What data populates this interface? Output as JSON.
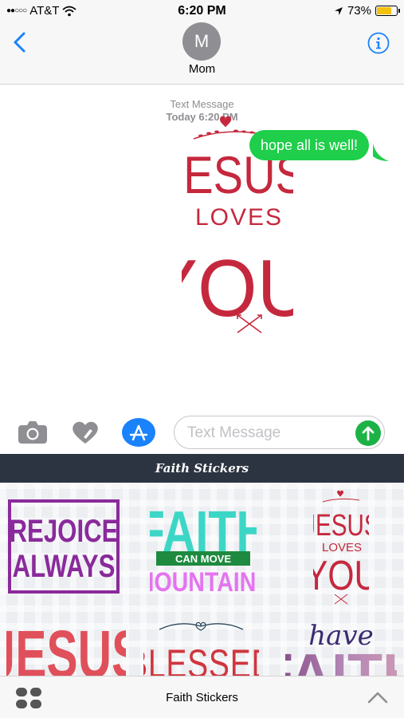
{
  "status": {
    "carrier": "AT&T",
    "signal_dots": "●●○○○",
    "time": "6:20 PM",
    "battery": "73%",
    "battery_level": 0.73,
    "battery_color": "#f4c20d"
  },
  "header": {
    "avatar_initial": "M",
    "contact": "Mom"
  },
  "conversation": {
    "timestamp_label": "Text Message",
    "timestamp_time": "Today 6:20 PM",
    "outgoing_message": "hope all is well!",
    "bubble_color": "#1fce4a"
  },
  "input": {
    "placeholder": "Text Message",
    "value": ""
  },
  "drawer": {
    "title": "Faith Stickers",
    "stickers": [
      {
        "name": "rejoice-always",
        "lines": [
          "REJOICE",
          "ALWAYS"
        ]
      },
      {
        "name": "faith-can-move-mountains",
        "lines": [
          "FAITH",
          "CAN MOVE",
          "MOUNTAINS"
        ]
      },
      {
        "name": "jesus-loves-you",
        "lines": [
          "JESUS",
          "LOVES",
          "YOU"
        ]
      },
      {
        "name": "jesus",
        "lines": [
          "JESUS"
        ]
      },
      {
        "name": "blessed",
        "lines": [
          "BLESSED"
        ]
      },
      {
        "name": "have-faith",
        "lines": [
          "have",
          "FAITH"
        ]
      }
    ]
  },
  "main_sticker": {
    "lines": [
      "JESUS",
      "LOVES",
      "YOU"
    ]
  },
  "bottom_bar": {
    "title": "Faith Stickers"
  },
  "colors": {
    "ios_blue": "#1a82fb",
    "sticker_red": "#c5283d",
    "rejoice_purple": "#8a2a9b",
    "faith_teal": "#3cd6c6",
    "faith_green": "#1e8a3f",
    "mountains_pink": "#e474f0"
  }
}
